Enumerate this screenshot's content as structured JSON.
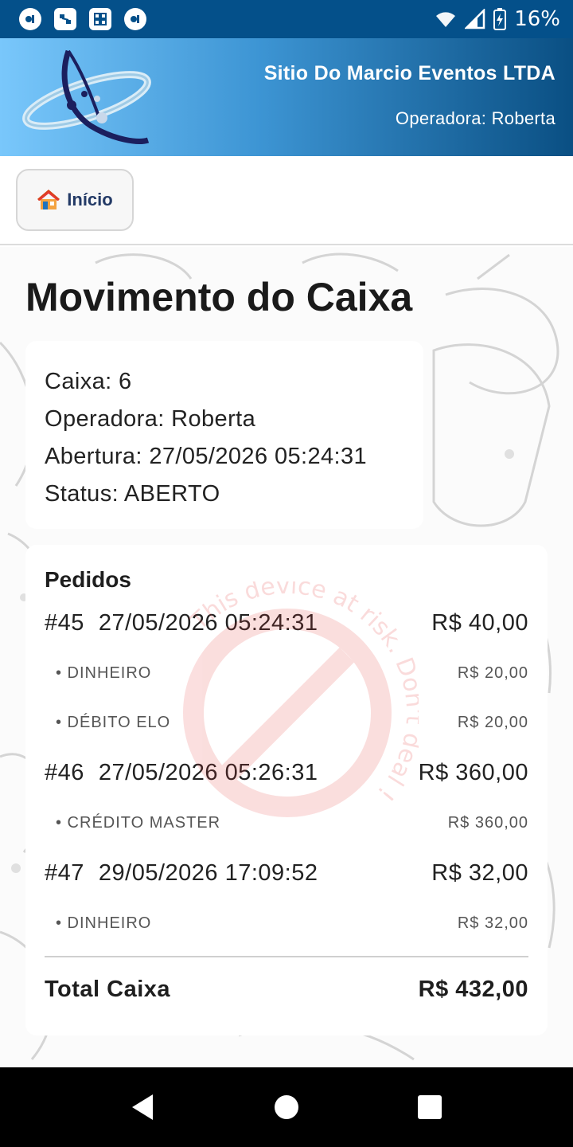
{
  "status_bar": {
    "battery": "16%",
    "icons_left": [
      "app-icon",
      "network-icon",
      "grid-app-icon",
      "app-icon"
    ],
    "icons_right": [
      "wifi-icon",
      "signal-icon",
      "battery-charging-icon"
    ]
  },
  "header": {
    "company": "Sitio Do Marcio Eventos LTDA",
    "operator": "Operadora: Roberta",
    "colors": {
      "gradient_start": "#79c7fb",
      "gradient_end": "#0a4f83"
    }
  },
  "nav": {
    "home_label": "Início",
    "home_icon": "house-icon"
  },
  "page": {
    "title": "Movimento do Caixa"
  },
  "info": {
    "caixa": "Caixa: 6",
    "operadora": "Operadora: Roberta",
    "abertura": "Abertura: 27/05/2026 05:24:31",
    "status": "Status: ABERTO"
  },
  "orders": {
    "title": "Pedidos",
    "items": [
      {
        "number": "#45",
        "datetime": "27/05/2026 05:24:31",
        "amount": "R$ 40,00",
        "payments": [
          {
            "method": "• DINHEIRO",
            "amount": "R$ 20,00"
          },
          {
            "method": "• DÉBITO ELO",
            "amount": "R$ 20,00"
          }
        ]
      },
      {
        "number": "#46",
        "datetime": "27/05/2026 05:26:31",
        "amount": "R$ 360,00",
        "payments": [
          {
            "method": "• CRÉDITO MASTER",
            "amount": "R$ 360,00"
          }
        ]
      },
      {
        "number": "#47",
        "datetime": "29/05/2026 17:09:52",
        "amount": "R$ 32,00",
        "payments": [
          {
            "method": "• DINHEIRO",
            "amount": "R$ 32,00"
          }
        ]
      }
    ],
    "total_label": "Total Caixa",
    "total_value": "R$ 432,00"
  },
  "watermark": {
    "text": "This device at risk. Don't deal !",
    "color": "#e53935"
  },
  "system_nav": {
    "back": "back-icon",
    "home": "home-circle-icon",
    "recents": "recents-square-icon"
  }
}
